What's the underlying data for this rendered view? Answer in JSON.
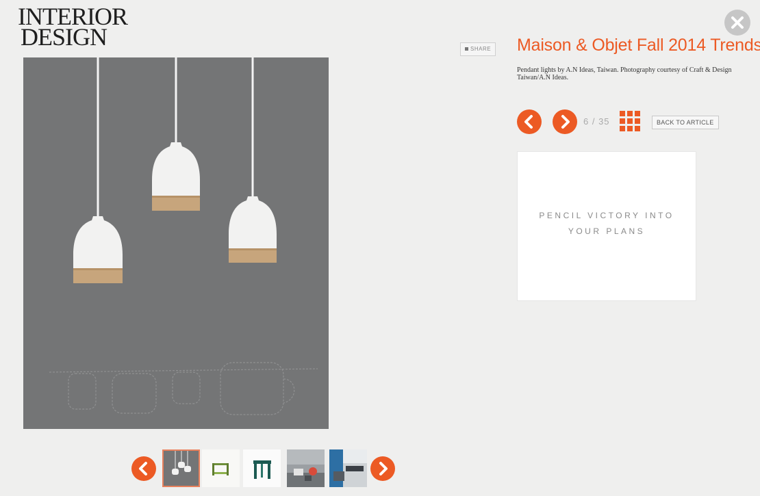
{
  "brand": {
    "line1": "INTERIOR",
    "line2": "DESIGN"
  },
  "header": {
    "close_icon": "close-icon"
  },
  "gallery": {
    "share_label": "SHARE",
    "title": "Maison & Objet Fall 2014 Trends",
    "caption": "Pendant lights by A.N Ideas, Taiwan. Photography courtesy of Craft & Design Taiwan/A.N Ideas.",
    "counter": "6 / 35",
    "back_label": "BACK TO ARTICLE"
  },
  "ad": {
    "line1": "PENCIL VICTORY INTO",
    "line2": "YOUR PLANS"
  },
  "thumbnails": [
    {
      "subject": "pendant-lights",
      "active": true
    },
    {
      "subject": "green-side-table",
      "active": false
    },
    {
      "subject": "teal-stool",
      "active": false
    },
    {
      "subject": "room-with-chairs",
      "active": false
    },
    {
      "subject": "office-interior",
      "active": false
    }
  ],
  "colors": {
    "accent": "#ec5a24",
    "image_background": "#747576",
    "page_background": "#efefee"
  }
}
